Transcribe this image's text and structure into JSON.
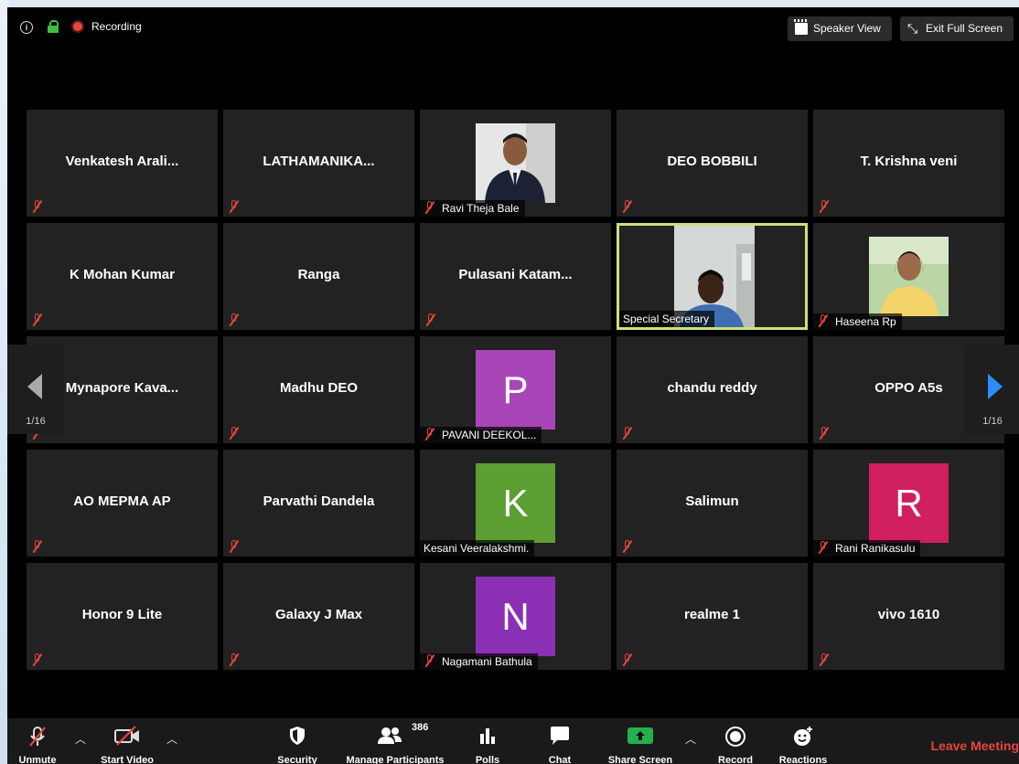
{
  "topbar": {
    "recording_label": "Recording",
    "speaker_view_label": "Speaker View",
    "exit_fullscreen_label": "Exit Full Screen"
  },
  "gallery": {
    "page_left": "1/16",
    "page_right": "1/16",
    "tiles": [
      {
        "name": "Venkatesh  Arali...",
        "kind": "name"
      },
      {
        "name": "LATHAMANIKA...",
        "kind": "name"
      },
      {
        "name": "Ravi Theja Bale",
        "kind": "photo"
      },
      {
        "name": "DEO BOBBILI",
        "kind": "name"
      },
      {
        "name": "T. Krishna veni",
        "kind": "name"
      },
      {
        "name": "K Mohan Kumar",
        "kind": "name"
      },
      {
        "name": "Ranga",
        "kind": "name"
      },
      {
        "name": "Pulasani  Katam...",
        "kind": "name"
      },
      {
        "name": "Special Secretary",
        "kind": "video"
      },
      {
        "name": "Haseena Rp",
        "kind": "photo"
      },
      {
        "name": "Mynapore  Kava...",
        "kind": "name"
      },
      {
        "name": "Madhu DEO",
        "kind": "name"
      },
      {
        "name": "PAVANI DEEKOL...",
        "kind": "avatar",
        "letter": "P",
        "color": "#a846b8"
      },
      {
        "name": "chandu reddy",
        "kind": "name"
      },
      {
        "name": "OPPO A5s",
        "kind": "name"
      },
      {
        "name": "AO MEPMA AP",
        "kind": "name"
      },
      {
        "name": "Parvathi Dandela",
        "kind": "name"
      },
      {
        "name": "Kesani Veeralakshmi.",
        "kind": "avatar",
        "letter": "K",
        "color": "#5c9e31"
      },
      {
        "name": "Salimun",
        "kind": "name"
      },
      {
        "name": "Rani Ranikasulu",
        "kind": "avatar",
        "letter": "R",
        "color": "#cf1f5e"
      },
      {
        "name": "Honor 9 Lite",
        "kind": "name"
      },
      {
        "name": "Galaxy J Max",
        "kind": "name"
      },
      {
        "name": "Nagamani Bathula",
        "kind": "avatar",
        "letter": "N",
        "color": "#8b2fb5"
      },
      {
        "name": "realme 1",
        "kind": "name"
      },
      {
        "name": "vivo 1610",
        "kind": "name"
      }
    ]
  },
  "toolbar": {
    "unmute_label": "Unmute",
    "start_video_label": "Start Video",
    "security_label": "Security",
    "participants_label": "Manage Participants",
    "participants_count": "386",
    "polls_label": "Polls",
    "chat_label": "Chat",
    "share_label": "Share Screen",
    "record_label": "Record",
    "reactions_label": "Reactions",
    "leave_label": "Leave Meeting"
  },
  "colors": {
    "active_speaker_border": "#cde27b",
    "muted_red": "#e8453c",
    "share_green": "#23b14d",
    "nav_blue": "#2d8cff"
  }
}
